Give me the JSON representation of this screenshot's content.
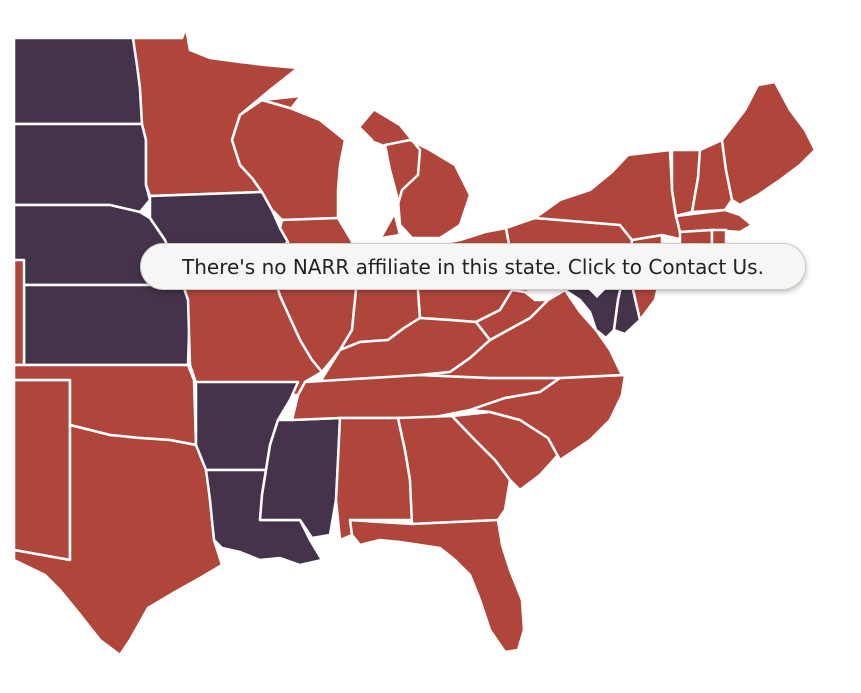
{
  "map": {
    "colors": {
      "affiliate": "#b0463b",
      "no_affiliate": "#44334a",
      "border": "#ffffff"
    },
    "states": [
      {
        "id": "ND",
        "status": "no_affiliate"
      },
      {
        "id": "SD",
        "status": "no_affiliate"
      },
      {
        "id": "NE",
        "status": "no_affiliate"
      },
      {
        "id": "KS",
        "status": "no_affiliate"
      },
      {
        "id": "IA",
        "status": "no_affiliate"
      },
      {
        "id": "AR",
        "status": "no_affiliate"
      },
      {
        "id": "LA",
        "status": "no_affiliate"
      },
      {
        "id": "MS",
        "status": "no_affiliate"
      },
      {
        "id": "MD",
        "status": "no_affiliate"
      },
      {
        "id": "DE",
        "status": "no_affiliate"
      },
      {
        "id": "MN",
        "status": "affiliate"
      },
      {
        "id": "WI",
        "status": "affiliate"
      },
      {
        "id": "MI",
        "status": "affiliate"
      },
      {
        "id": "IL",
        "status": "affiliate"
      },
      {
        "id": "IN",
        "status": "affiliate"
      },
      {
        "id": "OH",
        "status": "affiliate"
      },
      {
        "id": "MO",
        "status": "affiliate"
      },
      {
        "id": "OK",
        "status": "affiliate"
      },
      {
        "id": "TX",
        "status": "affiliate"
      },
      {
        "id": "KY",
        "status": "affiliate"
      },
      {
        "id": "TN",
        "status": "affiliate"
      },
      {
        "id": "AL",
        "status": "affiliate"
      },
      {
        "id": "GA",
        "status": "affiliate"
      },
      {
        "id": "FL",
        "status": "affiliate"
      },
      {
        "id": "SC",
        "status": "affiliate"
      },
      {
        "id": "NC",
        "status": "affiliate"
      },
      {
        "id": "VA",
        "status": "affiliate"
      },
      {
        "id": "WV",
        "status": "affiliate"
      },
      {
        "id": "PA",
        "status": "affiliate"
      },
      {
        "id": "NY",
        "status": "affiliate"
      },
      {
        "id": "NJ",
        "status": "affiliate"
      },
      {
        "id": "CT",
        "status": "affiliate"
      },
      {
        "id": "RI",
        "status": "affiliate"
      },
      {
        "id": "MA",
        "status": "affiliate"
      },
      {
        "id": "VT",
        "status": "affiliate"
      },
      {
        "id": "NH",
        "status": "affiliate"
      },
      {
        "id": "ME",
        "status": "affiliate"
      },
      {
        "id": "NM",
        "status": "affiliate"
      },
      {
        "id": "CO",
        "status": "affiliate"
      }
    ]
  },
  "tooltip": {
    "text": "There's no NARR affiliate in this state. Click to Contact Us."
  }
}
